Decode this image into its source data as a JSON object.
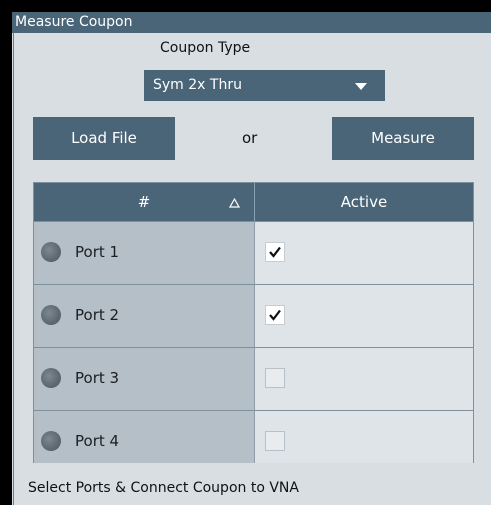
{
  "panel": {
    "title": "Measure Coupon"
  },
  "coupon_type": {
    "label": "Coupon Type",
    "selected": "Sym 2x Thru"
  },
  "buttons": {
    "load": "Load File",
    "or": "or",
    "measure": "Measure"
  },
  "table": {
    "headers": {
      "num": "#",
      "active": "Active"
    },
    "rows": [
      {
        "port": "Port 1",
        "active": true
      },
      {
        "port": "Port 2",
        "active": true
      },
      {
        "port": "Port 3",
        "active": false
      },
      {
        "port": "Port 4",
        "active": false
      }
    ]
  },
  "status": "Select Ports & Connect Coupon to VNA",
  "colors": {
    "header": "#4a6478",
    "panel_bg": "#d8dee2",
    "port_cell": "#b4bfc7",
    "active_cell": "#dfe4e8"
  }
}
